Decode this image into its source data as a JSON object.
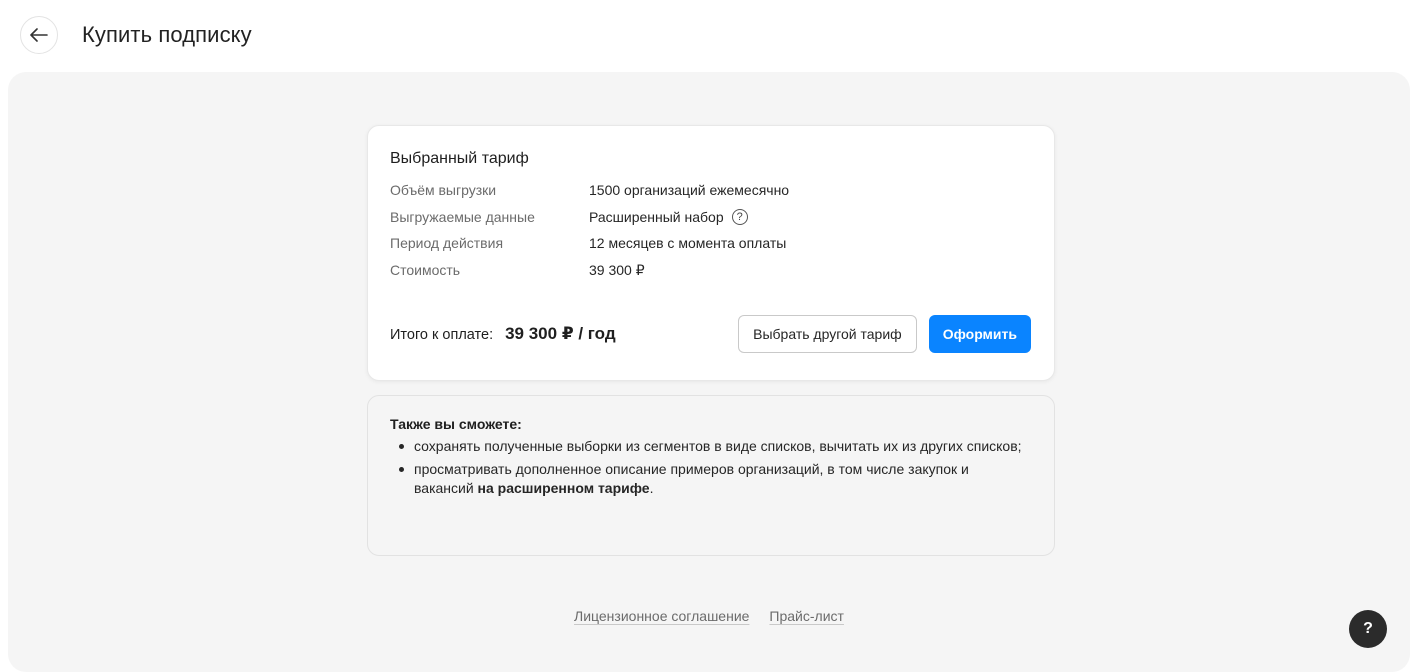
{
  "header": {
    "title": "Купить подписку",
    "back_icon": "arrow-left-icon"
  },
  "card": {
    "title": "Выбранный тариф",
    "rows": [
      {
        "label": "Объём выгрузки",
        "value": "1500 организаций ежемесячно"
      },
      {
        "label": "Выгружаемые данные",
        "value": "Расширенный набор"
      },
      {
        "label": "Период действия",
        "value": "12 месяцев с момента оплаты"
      },
      {
        "label": "Стоимость",
        "value": "39 300 ₽"
      }
    ],
    "help_glyph": "?",
    "total_label": "Итого к оплате:",
    "total_amount": "39 300 ₽ / год",
    "choose_other_label": "Выбрать другой тариф",
    "checkout_label": "Оформить",
    "accent_color": "#0a84ff"
  },
  "info": {
    "title": "Также вы сможете:",
    "items": [
      {
        "text": "сохранять полученные выборки из сегментов в виде списков, вычитать их из других списков;"
      },
      {
        "text": "просматривать дополненное описание примеров организаций, в том числе закупок и вакансий ",
        "bold": "на расширенном тарифе",
        "tail": "."
      }
    ]
  },
  "footer": {
    "license_link": "Лицензионное соглашение",
    "price_link": "Прайс-лист"
  },
  "help_button": {
    "label": "?",
    "icon": "question-icon"
  }
}
